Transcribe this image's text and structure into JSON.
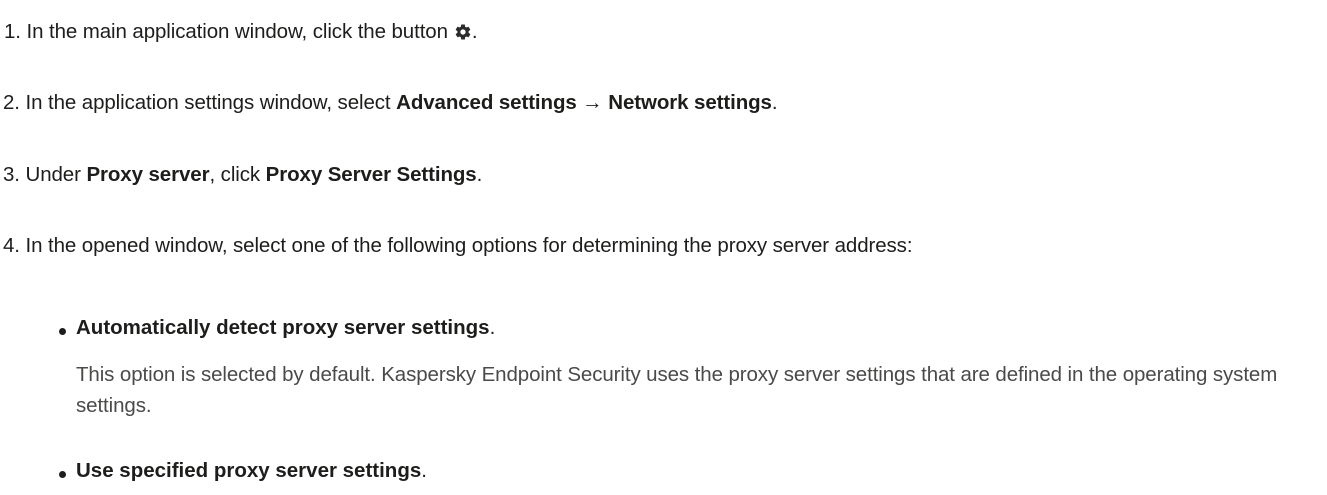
{
  "steps": {
    "step1": {
      "prefix": "1. In the main application window, click the button",
      "icon": "gear-icon",
      "suffix": "."
    },
    "step2": {
      "prefix": "2. In the application settings window, select ",
      "bold": "Advanced settings → Network settings",
      "suffix": "."
    },
    "step3": {
      "prefix": "3. Under ",
      "bold1": "Proxy server",
      "middle": ", click ",
      "bold2": "Proxy Server Settings",
      "suffix": "."
    },
    "step4": {
      "text": "4. In the opened window, select one of the following options for determining the proxy server address:"
    }
  },
  "options": [
    {
      "label": "Automatically detect proxy server settings",
      "suffix": ".",
      "description": "This option is selected by default. Kaspersky Endpoint Security uses the proxy server settings that are defined in the operating system settings."
    },
    {
      "label": "Use specified proxy server settings",
      "suffix": "."
    }
  ]
}
